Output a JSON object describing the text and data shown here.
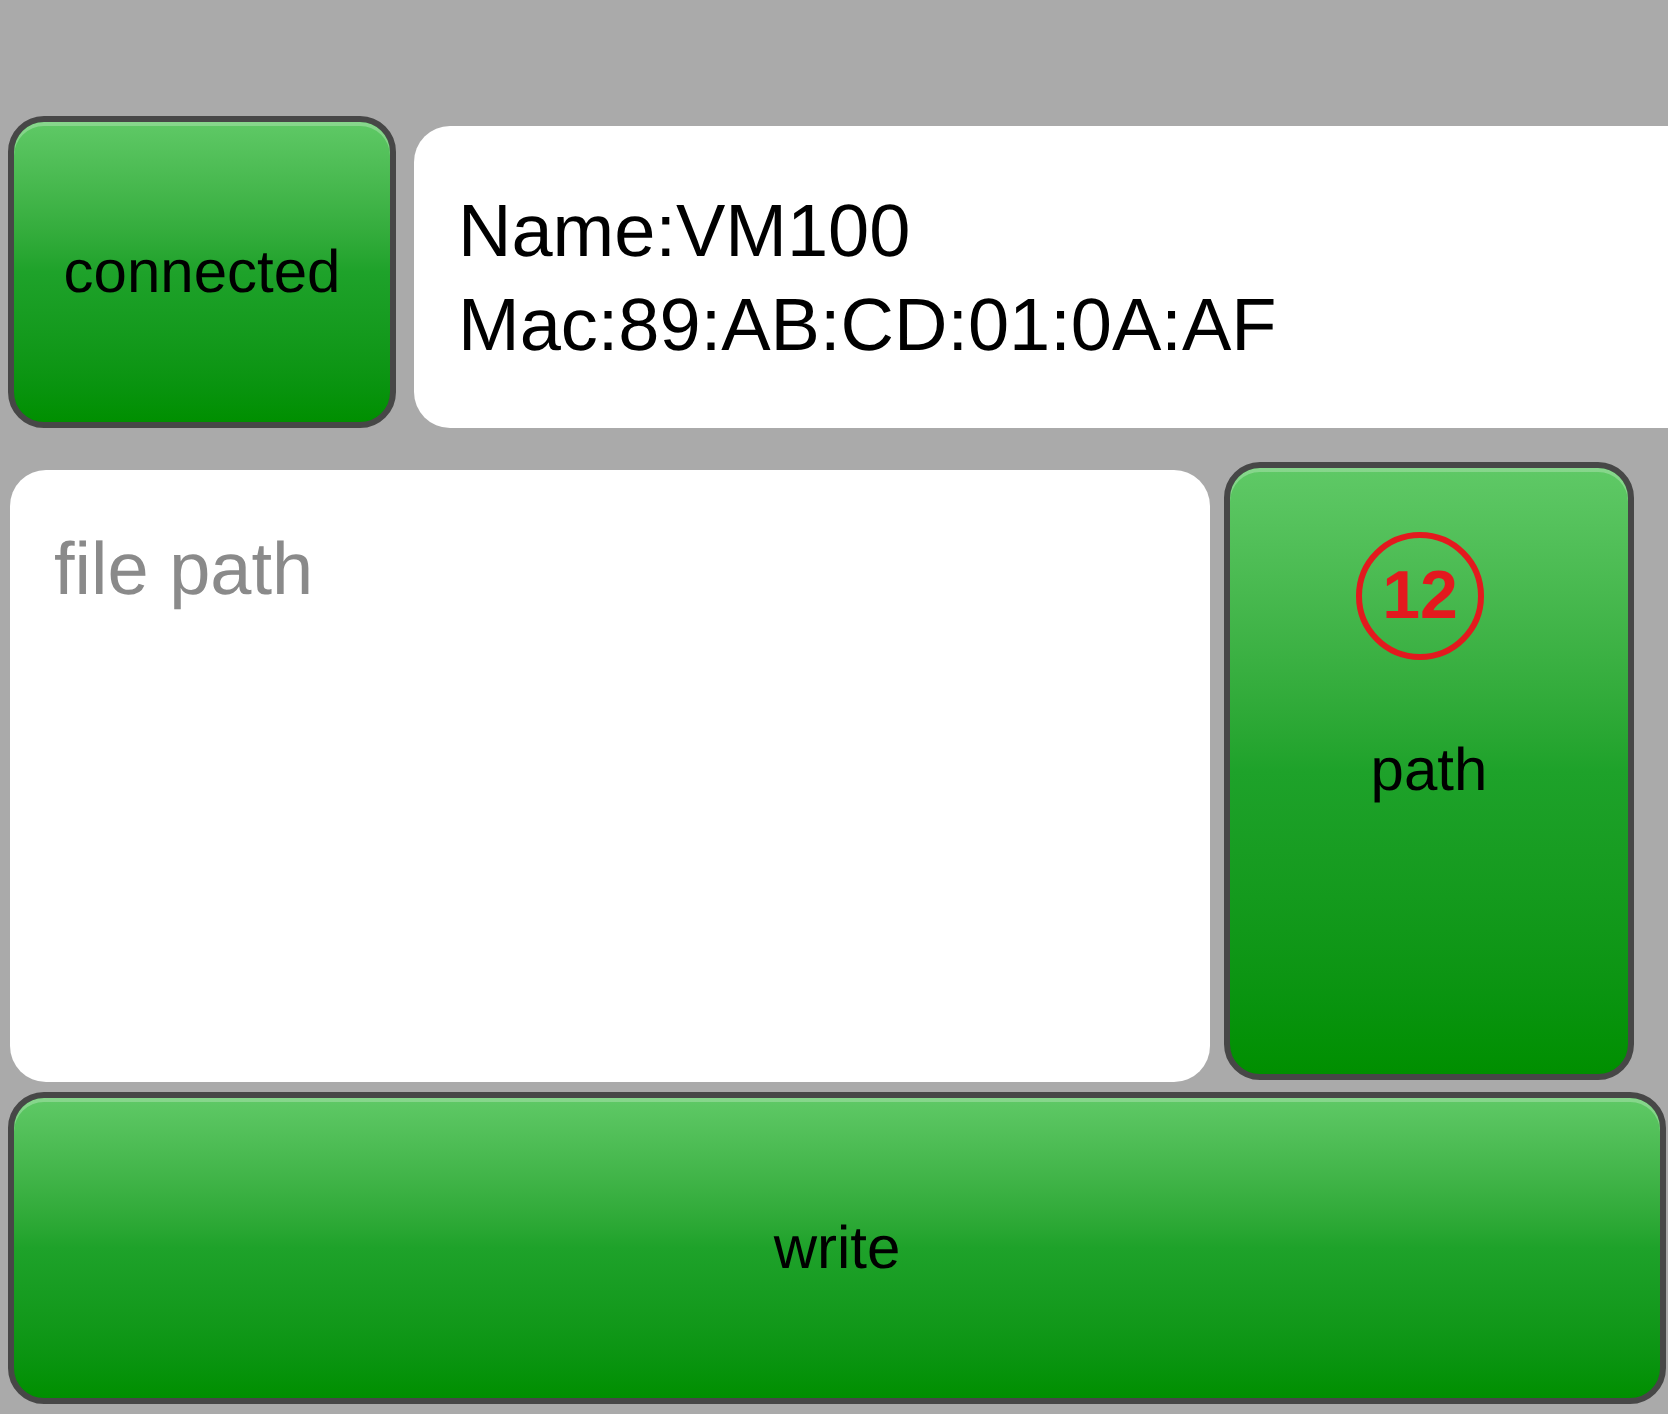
{
  "connection_button": {
    "label": "connected"
  },
  "device_info": {
    "name": "Name:VM100",
    "mac": "Mac:89:AB:CD:01:0A:AF"
  },
  "file_path_field": {
    "placeholder": "file path"
  },
  "path_button": {
    "label": "path",
    "badge": "12"
  },
  "write_button": {
    "label": "write"
  }
}
